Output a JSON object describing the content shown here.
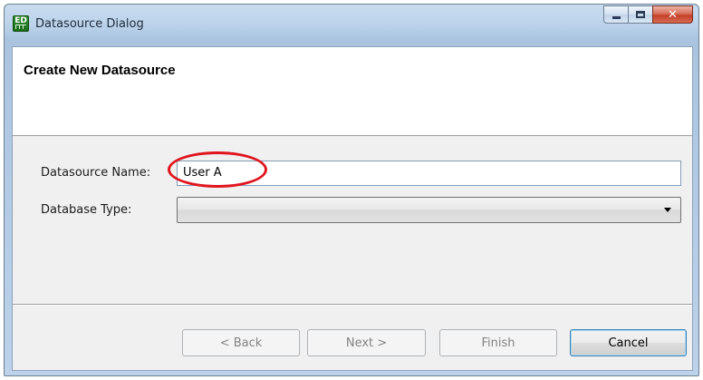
{
  "window": {
    "title": "Datasource Dialog",
    "app_icon_text": "ED",
    "controls": {
      "minimize": "minimize",
      "maximize": "maximize",
      "close": "✕"
    }
  },
  "header": {
    "title": "Create New Datasource"
  },
  "form": {
    "datasource_name_label": "Datasource Name:",
    "datasource_name_value": "User A",
    "database_type_label": "Database Type:",
    "database_type_value": ""
  },
  "buttons": {
    "back": "< Back",
    "next": "Next >",
    "finish": "Finish",
    "cancel": "Cancel"
  },
  "annotation": {
    "highlight_color": "#e0141e"
  }
}
